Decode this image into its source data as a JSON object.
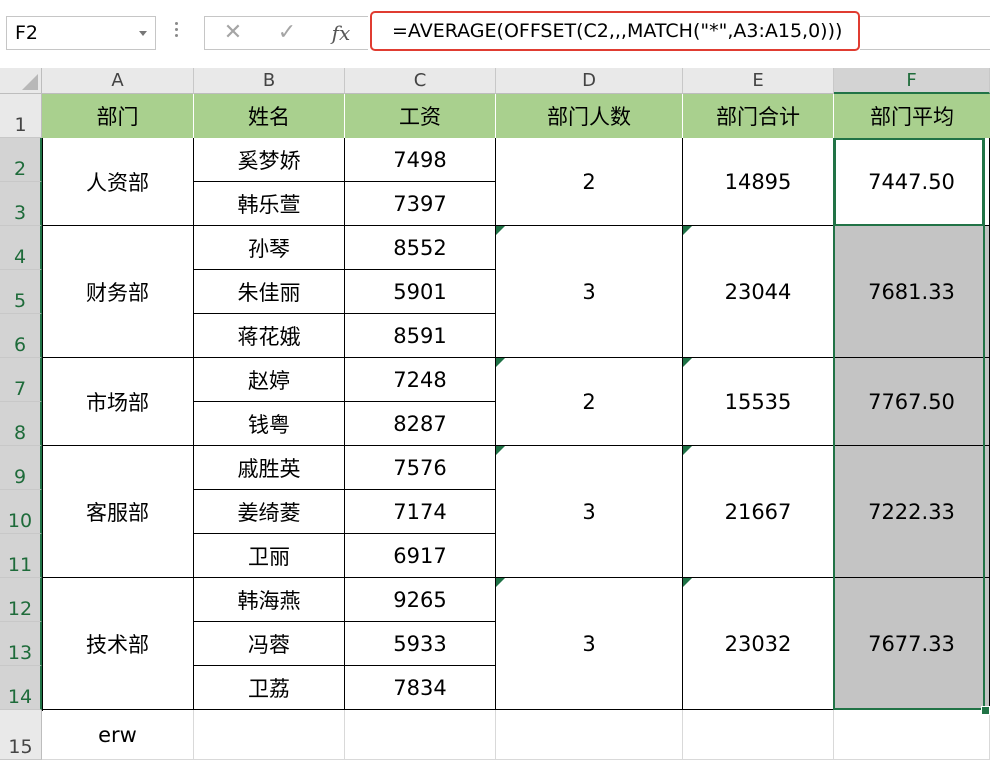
{
  "name_box": {
    "value": "F2"
  },
  "formula_bar": {
    "cancel_icon": "cancel-icon",
    "enter_icon": "enter-icon",
    "fx_label": "fx",
    "formula": "=AVERAGE(OFFSET(C2,,,MATCH(\"*\",A3:A15,0)))"
  },
  "columns": [
    "A",
    "B",
    "C",
    "D",
    "E",
    "F"
  ],
  "rows": [
    "1",
    "2",
    "3",
    "4",
    "5",
    "6",
    "7",
    "8",
    "9",
    "10",
    "11",
    "12",
    "13",
    "14",
    "15"
  ],
  "headers": [
    "部门",
    "姓名",
    "工资",
    "部门人数",
    "部门合计",
    "部门平均"
  ],
  "departments": [
    {
      "name": "人资部",
      "count": "2",
      "total": "14895",
      "average": "7447.50",
      "employees": [
        {
          "name": "奚梦娇",
          "salary": "7498"
        },
        {
          "name": "韩乐萱",
          "salary": "7397"
        }
      ]
    },
    {
      "name": "财务部",
      "count": "3",
      "total": "23044",
      "average": "7681.33",
      "employees": [
        {
          "name": "孙琴",
          "salary": "8552"
        },
        {
          "name": "朱佳丽",
          "salary": "5901"
        },
        {
          "name": "蒋花娥",
          "salary": "8591"
        }
      ]
    },
    {
      "name": "市场部",
      "count": "2",
      "total": "15535",
      "average": "7767.50",
      "employees": [
        {
          "name": "赵婷",
          "salary": "7248"
        },
        {
          "name": "钱粤",
          "salary": "8287"
        }
      ]
    },
    {
      "name": "客服部",
      "count": "3",
      "total": "21667",
      "average": "7222.33",
      "employees": [
        {
          "name": "戚胜英",
          "salary": "7576"
        },
        {
          "name": "姜绮菱",
          "salary": "7174"
        },
        {
          "name": "卫丽",
          "salary": "6917"
        }
      ]
    },
    {
      "name": "技术部",
      "count": "3",
      "total": "23032",
      "average": "7677.33",
      "employees": [
        {
          "name": "韩海燕",
          "salary": "9265"
        },
        {
          "name": "冯蓉",
          "salary": "5933"
        },
        {
          "name": "卫荔",
          "salary": "7834"
        }
      ]
    }
  ],
  "row15": {
    "a": "erw"
  },
  "colors": {
    "header_fill": "#a9d08e",
    "selection": "#217346",
    "selected_fill": "#c4c4c4"
  }
}
